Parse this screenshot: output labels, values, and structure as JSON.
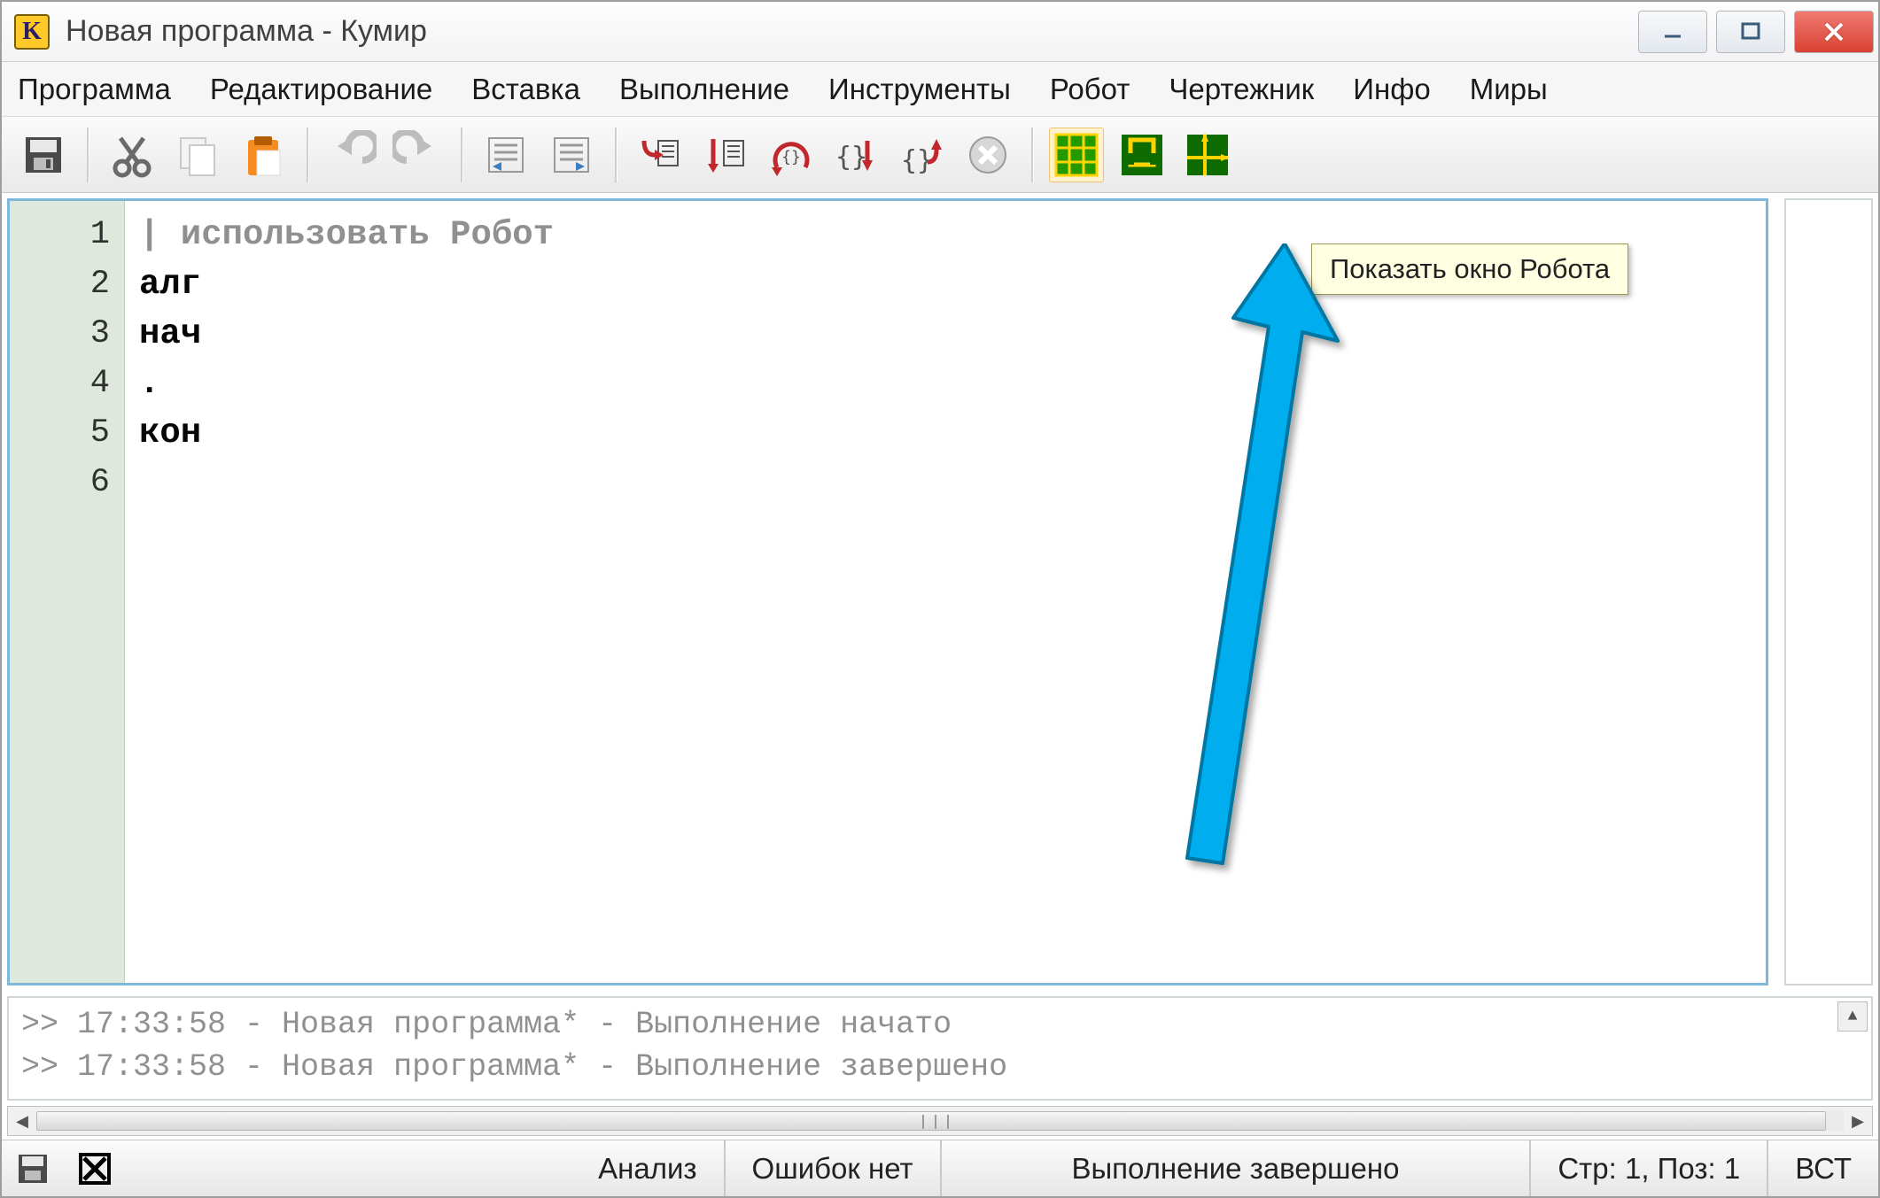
{
  "window": {
    "title": "Новая программа - Кумир",
    "app_icon_letter": "K"
  },
  "menu": {
    "items": [
      "Программа",
      "Редактирование",
      "Вставка",
      "Выполнение",
      "Инструменты",
      "Робот",
      "Чертежник",
      "Инфо",
      "Миры"
    ]
  },
  "tooltip": "Показать окно Робота",
  "editor": {
    "lines": [
      "1",
      "2",
      "3",
      "4",
      "5",
      "6"
    ],
    "code": {
      "l1": "| использовать Робот",
      "l2": "алг",
      "l3": "нач",
      "l4": ".",
      "l5": "кон",
      "l6": ""
    }
  },
  "console": {
    "line1": ">> 17:33:58 - Новая программа* - Выполнение начато",
    "line2": ">> 17:33:58 - Новая программа* - Выполнение завершено"
  },
  "status": {
    "analysis": "Анализ",
    "errors": "Ошибок нет",
    "exec": "Выполнение завершено",
    "pos": "Стр: 1, Поз: 1",
    "mode": "ВСТ"
  },
  "colors": {
    "green": "#229a00",
    "green_dark": "#0d6b00",
    "yellow": "#ffd400",
    "red": "#c1272d",
    "orange": "#f68b1f",
    "gray": "#9a9a9a",
    "cyan_arrow": "#00aeef"
  }
}
